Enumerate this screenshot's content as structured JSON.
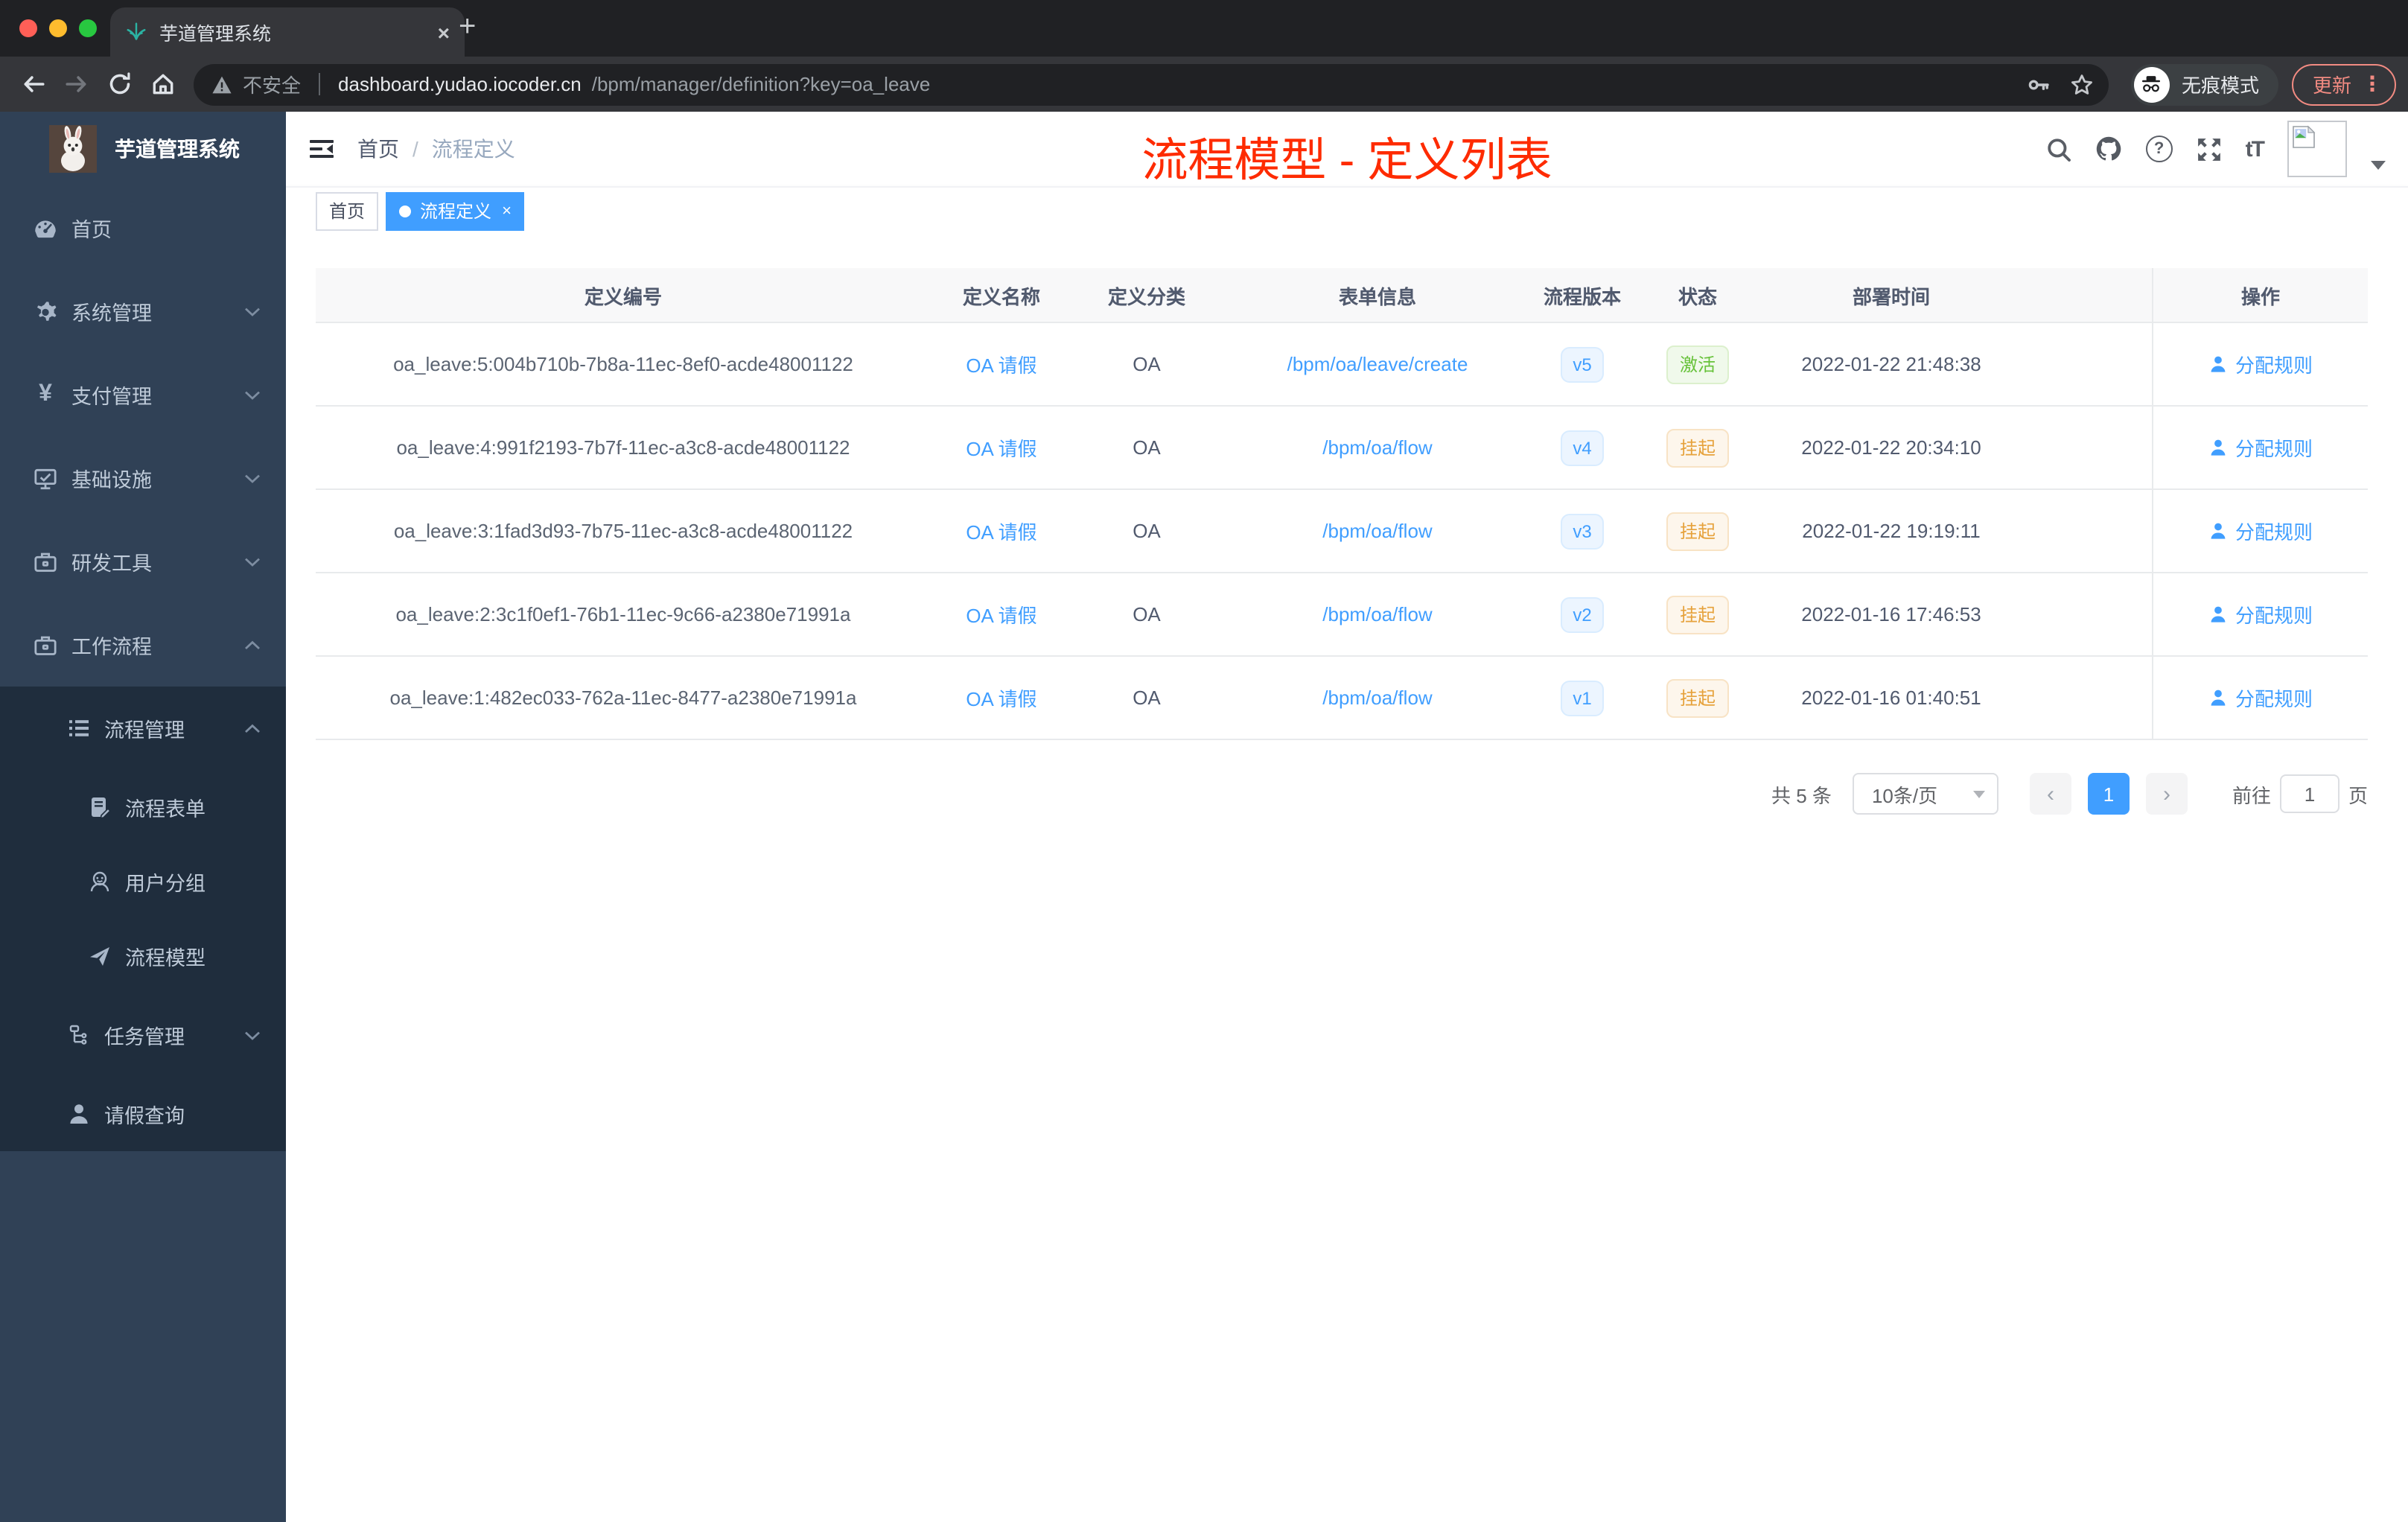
{
  "browser": {
    "tab_title": "芋道管理系统",
    "close_glyph": "×",
    "new_tab_glyph": "+",
    "security_label": "不安全",
    "url_domain": "dashboard.yudao.iocoder.cn",
    "url_path": "/bpm/manager/definition?key=oa_leave",
    "incognito_label": "无痕模式",
    "update_label": "更新",
    "menu_glyph": "⋮"
  },
  "header": {
    "breadcrumb_home": "首页",
    "breadcrumb_sep": "/",
    "breadcrumb_current": "流程定义",
    "annotation": "流程模型 - 定义列表",
    "help_glyph": "?",
    "font_icon": "tT"
  },
  "tags": {
    "home": "首页",
    "active": "流程定义",
    "close_glyph": "×"
  },
  "sidebar": {
    "title": "芋道管理系统",
    "items": [
      {
        "label": "首页"
      },
      {
        "label": "系统管理"
      },
      {
        "label": "支付管理"
      },
      {
        "label": "基础设施"
      },
      {
        "label": "研发工具"
      },
      {
        "label": "工作流程"
      },
      {
        "label": "流程管理"
      },
      {
        "label": "流程表单"
      },
      {
        "label": "用户分组"
      },
      {
        "label": "流程模型"
      },
      {
        "label": "任务管理"
      },
      {
        "label": "请假查询"
      }
    ]
  },
  "table": {
    "columns": {
      "id": "定义编号",
      "name": "定义名称",
      "category": "定义分类",
      "form": "表单信息",
      "version": "流程版本",
      "status": "状态",
      "deploy_time": "部署时间",
      "action": "操作"
    },
    "rows": [
      {
        "id": "oa_leave:5:004b710b-7b8a-11ec-8ef0-acde48001122",
        "name": "OA 请假",
        "category": "OA",
        "form": "/bpm/oa/leave/create",
        "version": "v5",
        "status": "激活",
        "status_type": "success",
        "time": "2022-01-22 21:48:38",
        "action": "分配规则"
      },
      {
        "id": "oa_leave:4:991f2193-7b7f-11ec-a3c8-acde48001122",
        "name": "OA 请假",
        "category": "OA",
        "form": "/bpm/oa/flow",
        "version": "v4",
        "status": "挂起",
        "status_type": "warning",
        "time": "2022-01-22 20:34:10",
        "action": "分配规则"
      },
      {
        "id": "oa_leave:3:1fad3d93-7b75-11ec-a3c8-acde48001122",
        "name": "OA 请假",
        "category": "OA",
        "form": "/bpm/oa/flow",
        "version": "v3",
        "status": "挂起",
        "status_type": "warning",
        "time": "2022-01-22 19:19:11",
        "action": "分配规则"
      },
      {
        "id": "oa_leave:2:3c1f0ef1-76b1-11ec-9c66-a2380e71991a",
        "name": "OA 请假",
        "category": "OA",
        "form": "/bpm/oa/flow",
        "version": "v2",
        "status": "挂起",
        "status_type": "warning",
        "time": "2022-01-16 17:46:53",
        "action": "分配规则"
      },
      {
        "id": "oa_leave:1:482ec033-762a-11ec-8477-a2380e71991a",
        "name": "OA 请假",
        "category": "OA",
        "form": "/bpm/oa/flow",
        "version": "v1",
        "status": "挂起",
        "status_type": "warning",
        "time": "2022-01-16 01:40:51",
        "action": "分配规则"
      }
    ]
  },
  "pagination": {
    "total": "共 5 条",
    "page_size": "10条/页",
    "prev_glyph": "‹",
    "page": "1",
    "next_glyph": "›",
    "goto_label": "前往",
    "goto_value": "1",
    "goto_unit": "页"
  },
  "colors": {
    "accent_blue": "#409eff",
    "annotation_red": "#fe2b00",
    "status_active_green": "#67c23a",
    "status_suspend_orange": "#e6a23c",
    "update_salmon": "#f28b82",
    "sidebar_bg": "#304156",
    "submenu_bg": "#1f2d3d"
  }
}
